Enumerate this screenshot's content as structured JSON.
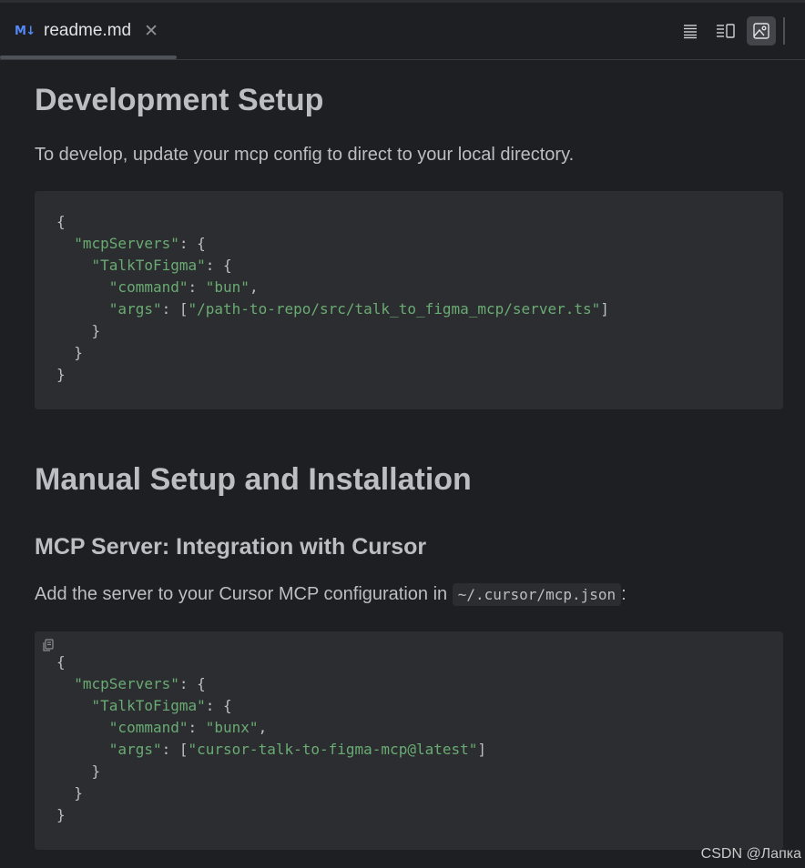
{
  "tab": {
    "icon_text": "M↓",
    "title": "readme.md",
    "close": "✕"
  },
  "toolbar": {
    "buttons": [
      {
        "name": "editor-only-icon",
        "active": false
      },
      {
        "name": "editor-and-preview-icon",
        "active": false
      },
      {
        "name": "preview-only-icon",
        "active": true
      }
    ]
  },
  "doc": {
    "h1_dev": "Development Setup",
    "p_dev": "To develop, update your mcp config to direct to your local directory.",
    "code1": [
      [
        [
          "p",
          "{"
        ]
      ],
      [
        [
          "p",
          "  "
        ],
        [
          "s",
          "\"mcpServers\""
        ],
        [
          "p",
          ": {"
        ]
      ],
      [
        [
          "p",
          "    "
        ],
        [
          "s",
          "\"TalkToFigma\""
        ],
        [
          "p",
          ": {"
        ]
      ],
      [
        [
          "p",
          "      "
        ],
        [
          "s",
          "\"command\""
        ],
        [
          "p",
          ": "
        ],
        [
          "s",
          "\"bun\""
        ],
        [
          "p",
          ","
        ]
      ],
      [
        [
          "p",
          "      "
        ],
        [
          "s",
          "\"args\""
        ],
        [
          "p",
          ": ["
        ],
        [
          "s",
          "\"/path-to-repo/src/talk_to_figma_mcp/server.ts\""
        ],
        [
          "p",
          "]"
        ]
      ],
      [
        [
          "p",
          "    }"
        ]
      ],
      [
        [
          "p",
          "  }"
        ]
      ],
      [
        [
          "p",
          "}"
        ]
      ]
    ],
    "h1_manual": "Manual Setup and Installation",
    "h2_mcp": "MCP Server: Integration with Cursor",
    "p_add_before": "Add the server to your Cursor MCP configuration in ",
    "p_add_code": "~/.cursor/mcp.json",
    "p_add_after": ":",
    "code2": [
      [
        [
          "p",
          "{"
        ]
      ],
      [
        [
          "p",
          "  "
        ],
        [
          "s",
          "\"mcpServers\""
        ],
        [
          "p",
          ": {"
        ]
      ],
      [
        [
          "p",
          "    "
        ],
        [
          "s",
          "\"TalkToFigma\""
        ],
        [
          "p",
          ": {"
        ]
      ],
      [
        [
          "p",
          "      "
        ],
        [
          "s",
          "\"command\""
        ],
        [
          "p",
          ": "
        ],
        [
          "s",
          "\"bunx\""
        ],
        [
          "p",
          ","
        ]
      ],
      [
        [
          "p",
          "      "
        ],
        [
          "s",
          "\"args\""
        ],
        [
          "p",
          ": ["
        ],
        [
          "s",
          "\"cursor-talk-to-figma-mcp@latest\""
        ],
        [
          "p",
          "]"
        ]
      ],
      [
        [
          "p",
          "    }"
        ]
      ],
      [
        [
          "p",
          "  }"
        ]
      ],
      [
        [
          "p",
          "}"
        ]
      ]
    ]
  },
  "watermark": "CSDN @Лапка",
  "colors": {
    "string": "#6aab73",
    "background": "#1e1f22",
    "code_bg": "#2b2d30",
    "md_icon": "#548af7"
  }
}
